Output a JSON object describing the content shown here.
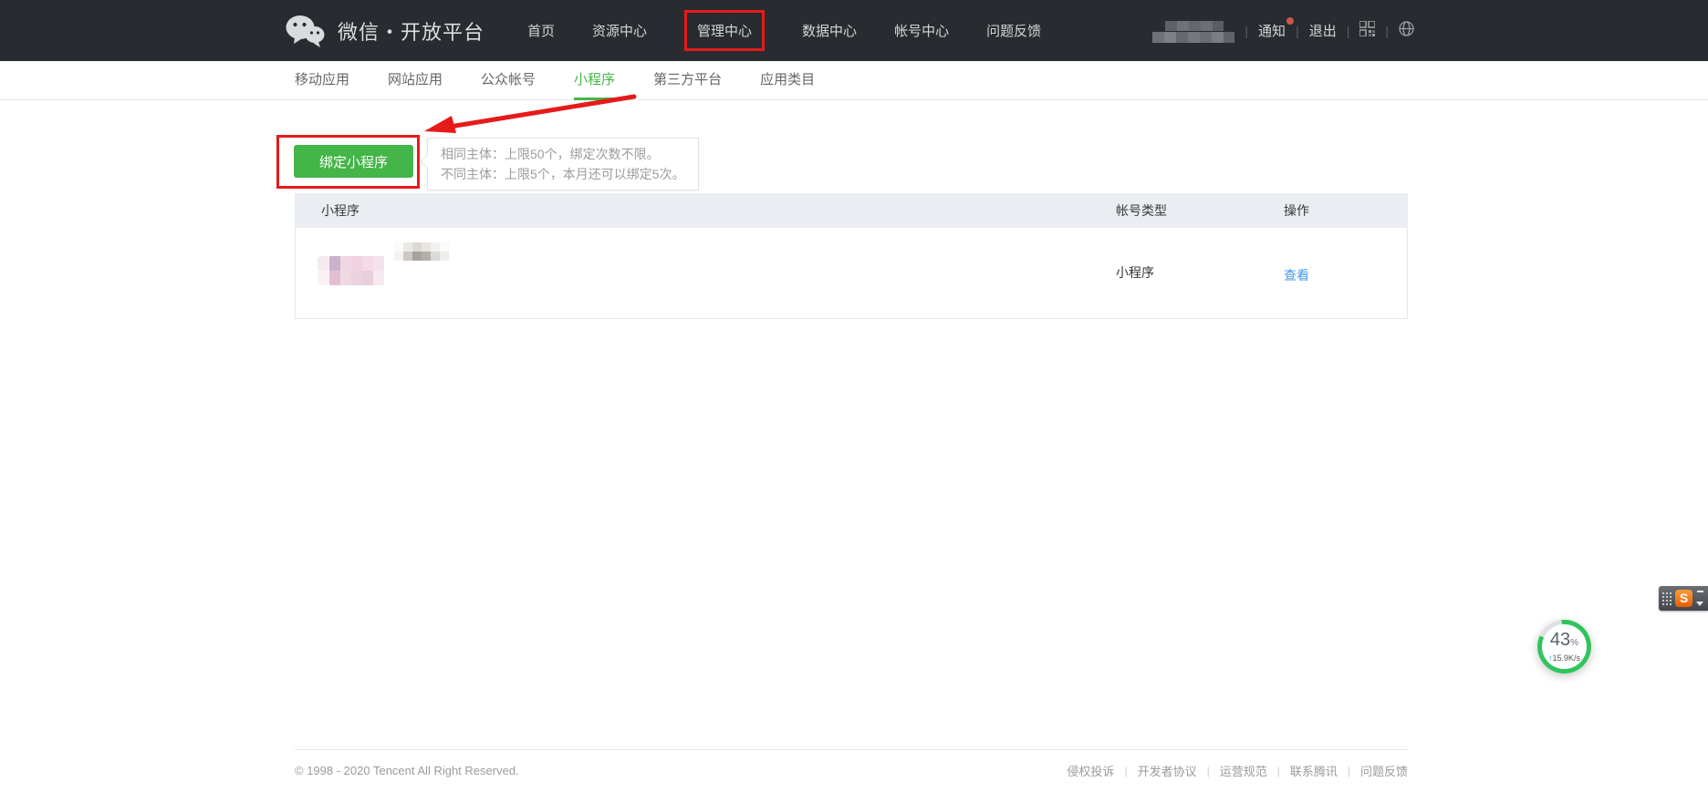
{
  "header": {
    "logo_text": "微信・开放平台",
    "nav": [
      {
        "label": "首页"
      },
      {
        "label": "资源中心"
      },
      {
        "label": "管理中心"
      },
      {
        "label": "数据中心"
      },
      {
        "label": "帐号中心"
      },
      {
        "label": "问题反馈"
      }
    ],
    "notice_label": "通知",
    "logout_label": "退出"
  },
  "subnav": {
    "items": [
      {
        "label": "移动应用"
      },
      {
        "label": "网站应用"
      },
      {
        "label": "公众帐号"
      },
      {
        "label": "小程序"
      },
      {
        "label": "第三方平台"
      },
      {
        "label": "应用类目"
      }
    ],
    "active_label": "小程序"
  },
  "content": {
    "bind_button_label": "绑定小程序",
    "tooltip_line1": "相同主体：上限50个，绑定次数不限。",
    "tooltip_line2": "不同主体：上限5个，本月还可以绑定5次。",
    "table": {
      "headers": {
        "col1": "小程序",
        "col2": "帐号类型",
        "col3": "操作"
      },
      "rows": [
        {
          "account_type": "小程序",
          "action": "查看"
        }
      ]
    }
  },
  "footer": {
    "copyright": "© 1998 - 2020 Tencent All Right Reserved.",
    "links": [
      {
        "label": "侵权投诉"
      },
      {
        "label": "开发者协议"
      },
      {
        "label": "运营规范"
      },
      {
        "label": "联系腾讯"
      },
      {
        "label": "问题反馈"
      }
    ]
  },
  "widgets": {
    "speed_percent": "43",
    "speed_unit": "%",
    "speed_arrow": "↑",
    "speed_rate": "15.9K/s",
    "ime_logo": "S"
  },
  "colors": {
    "wechat_green": "#44b549",
    "annotation_red": "#e71a1a",
    "link_blue": "#459ae9",
    "header_bg": "#282b2f",
    "table_header_bg": "#eaedf1",
    "notice_dot_red": "#c9574a"
  }
}
